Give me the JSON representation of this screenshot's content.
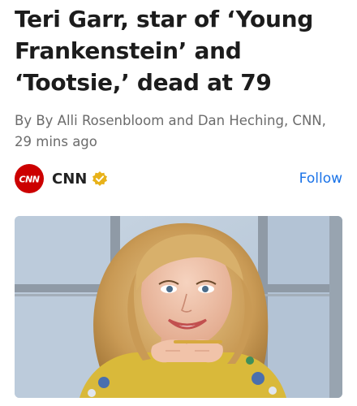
{
  "article": {
    "headline": "Teri Garr, star of ‘Young Frankenstein’ and ‘Tootsie,’ dead at 79",
    "byline": "By By Alli Rosenbloom and Dan Heching, CNN, 29 mins ago"
  },
  "source": {
    "logo_text": "CNN",
    "name": "CNN",
    "verified_icon": "verified-badge-icon",
    "follow_label": "Follow"
  },
  "colors": {
    "brand_red": "#cc0000",
    "follow_blue": "#1a73e8",
    "verified_gold": "#e8b21a"
  }
}
